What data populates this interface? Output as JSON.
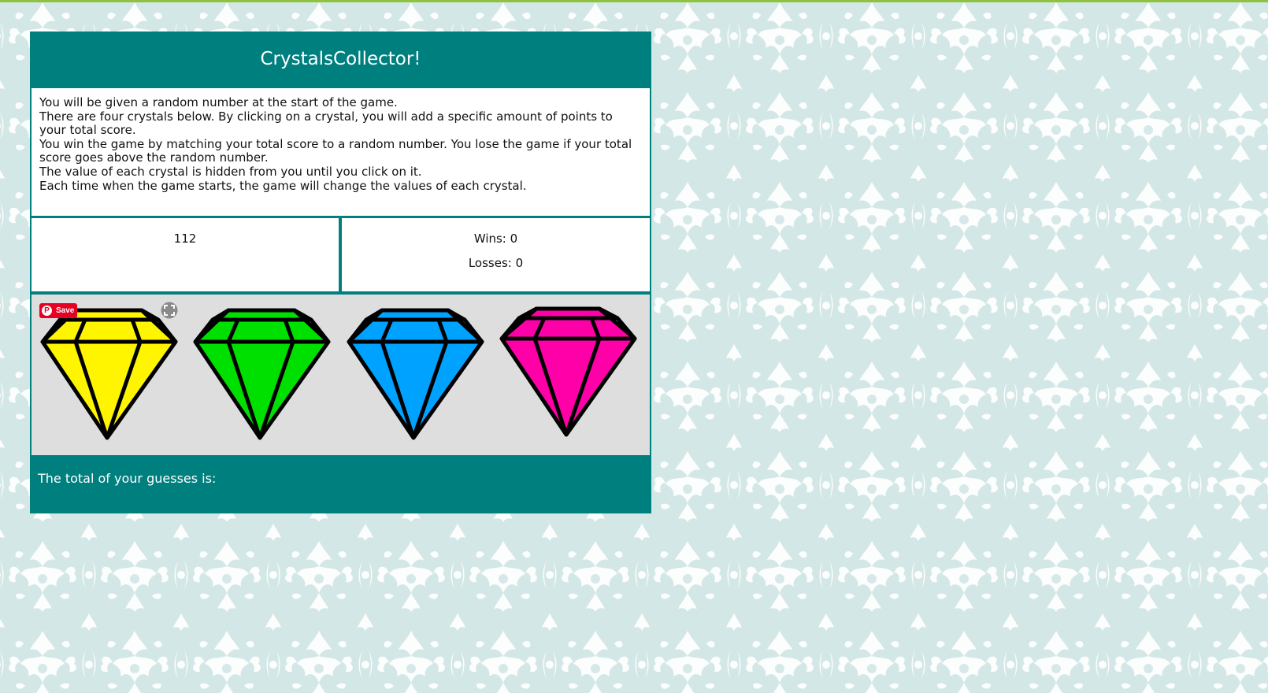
{
  "header": {
    "title": "CrystalsCollector!"
  },
  "instructions": [
    "You will be given a random number at the start of the game.",
    "There are four crystals below. By clicking on a crystal, you will add a specific amount of points to your total score.",
    "You win the game by matching your total score to a random number. You lose the game if your total score goes above the random number.",
    "The value of each crystal is hidden from you until you click on it.",
    "Each time when the game starts, the game will change the values of each crystal."
  ],
  "random_number": "112",
  "stats": {
    "wins": "Wins: 0",
    "losses": "Losses: 0"
  },
  "crystals": [
    {
      "color": "#fff500",
      "icon": "yellow-crystal-icon"
    },
    {
      "color": "#00e000",
      "icon": "green-crystal-icon"
    },
    {
      "color": "#00a2ff",
      "icon": "blue-crystal-icon"
    },
    {
      "color": "#ff00a8",
      "icon": "pink-crystal-icon"
    }
  ],
  "overlay": {
    "save_label": "Save",
    "save_icon": "pinterest-icon",
    "expand_icon": "expand-icon"
  },
  "footer": {
    "label": "The total of your guesses is:",
    "total": ""
  },
  "colors": {
    "teal": "#007f7f",
    "background": "#d3e8e6",
    "pattern": "#ffffff",
    "crystal_area": "#dedede",
    "pin_red": "#e60023"
  }
}
